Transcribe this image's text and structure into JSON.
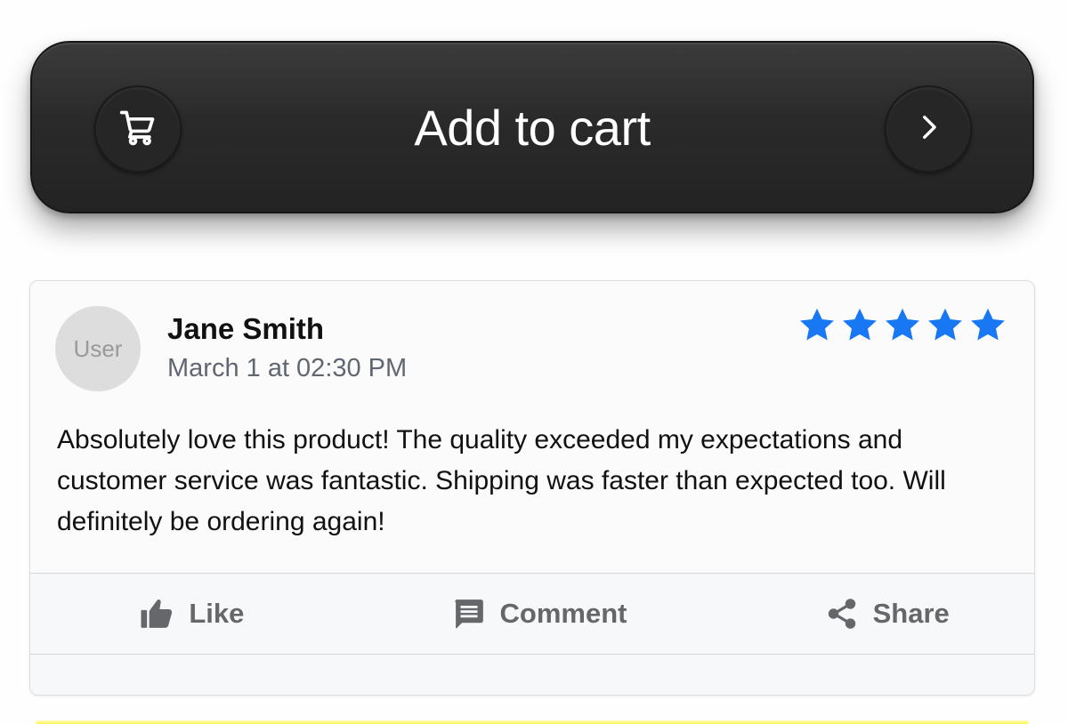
{
  "cart_button": {
    "label": "Add to cart",
    "leading_icon": "cart-icon",
    "trailing_icon": "chevron-right-icon"
  },
  "review": {
    "avatar_text": "User",
    "name": "Jane Smith",
    "date": "March 1 at 02:30 PM",
    "rating": 5,
    "rating_max": 5,
    "star_color": "#1877f2",
    "text": "Absolutely love this product! The quality exceeded my expectations and customer service was fantastic. Shipping was faster than expected too. Will definitely be ordering again!",
    "actions": {
      "like_label": "Like",
      "like_icon": "thumbs-up-icon",
      "comment_label": "Comment",
      "comment_icon": "comment-icon",
      "share_label": "Share",
      "share_icon": "share-icon"
    }
  }
}
